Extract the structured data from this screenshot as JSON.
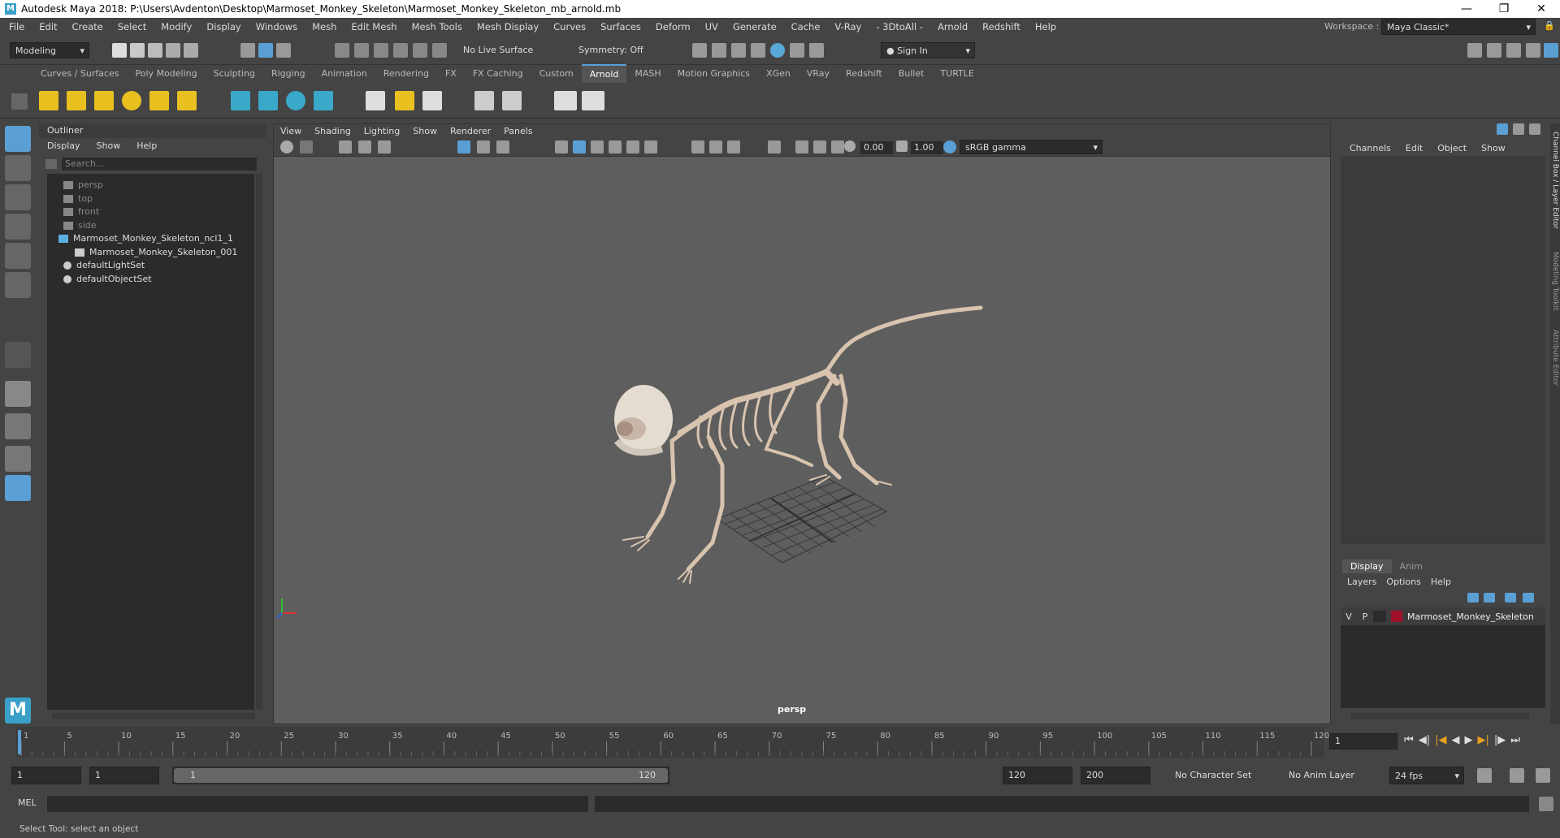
{
  "window": {
    "title": "Autodesk Maya 2018: P:\\Users\\Avdenton\\Desktop\\Marmoset_Monkey_Skeleton\\Marmoset_Monkey_Skeleton_mb_arnold.mb",
    "icon": "maya-icon",
    "controls": [
      "minimize-icon",
      "maximize-icon",
      "close-icon"
    ]
  },
  "menubar": {
    "items": [
      "File",
      "Edit",
      "Create",
      "Select",
      "Modify",
      "Display",
      "Windows",
      "Mesh",
      "Edit Mesh",
      "Mesh Tools",
      "Mesh Display",
      "Curves",
      "Surfaces",
      "Deform",
      "UV",
      "Generate",
      "Cache",
      "V-Ray",
      "- 3DtoAll -",
      "Arnold",
      "Redshift",
      "Help"
    ],
    "workspace_label": "Workspace :",
    "workspace_value": "Maya Classic*"
  },
  "statusline": {
    "mode": "Modeling",
    "live_surface": "No Live Surface",
    "symmetry": "Symmetry: Off",
    "sign_in": "Sign In"
  },
  "shelf": {
    "tabs": [
      "Curves / Surfaces",
      "Poly Modeling",
      "Sculpting",
      "Rigging",
      "Animation",
      "Rendering",
      "FX",
      "FX Caching",
      "Custom",
      "Arnold",
      "MASH",
      "Motion Graphics",
      "XGen",
      "VRay",
      "Redshift",
      "Bullet",
      "TURTLE"
    ],
    "active_tab": "Arnold"
  },
  "outliner": {
    "title": "Outliner",
    "menu": [
      "Display",
      "Show",
      "Help"
    ],
    "search_placeholder": "Search...",
    "items": [
      {
        "label": "persp",
        "icon": "camera-icon",
        "dim": true
      },
      {
        "label": "top",
        "icon": "camera-icon",
        "dim": true
      },
      {
        "label": "front",
        "icon": "camera-icon",
        "dim": true
      },
      {
        "label": "side",
        "icon": "camera-icon",
        "dim": true
      },
      {
        "label": "Marmoset_Monkey_Skeleton_ncl1_1",
        "icon": "joint-icon",
        "dim": false
      },
      {
        "label": "Marmoset_Monkey_Skeleton_001",
        "icon": "mesh-icon",
        "dim": false
      },
      {
        "label": "defaultLightSet",
        "icon": "set-icon",
        "dim": false
      },
      {
        "label": "defaultObjectSet",
        "icon": "set-icon",
        "dim": false
      }
    ]
  },
  "viewport": {
    "menu": [
      "View",
      "Shading",
      "Lighting",
      "Show",
      "Renderer",
      "Panels"
    ],
    "exposure": "0.00",
    "gamma": "1.00",
    "color_space": "sRGB gamma",
    "camera_label": "persp"
  },
  "channelbox": {
    "menu": [
      "Channels",
      "Edit",
      "Object",
      "Show"
    ],
    "side_tabs": [
      "Channel Box / Layer Editor",
      "Modeling Toolkit",
      "Attribute Editor"
    ],
    "layer_tabs": [
      "Display",
      "Anim"
    ],
    "layer_menu": [
      "Layers",
      "Options",
      "Help"
    ],
    "layer": {
      "v": "V",
      "p": "P",
      "name": "Marmoset_Monkey_Skeleton",
      "color": "#a0102a"
    }
  },
  "timeline": {
    "ticks": [
      "1",
      "5",
      "10",
      "15",
      "20",
      "25",
      "30",
      "35",
      "40",
      "45",
      "50",
      "55",
      "60",
      "65",
      "70",
      "75",
      "80",
      "85",
      "90",
      "95",
      "100",
      "105",
      "110",
      "115",
      "120"
    ],
    "current_frame": "1"
  },
  "range": {
    "start": "1",
    "playback_start": "1",
    "slider_start": "1",
    "slider_end": "120",
    "playback_end": "120",
    "end": "200",
    "character_set": "No Character Set",
    "anim_layer": "No Anim Layer",
    "fps": "24 fps"
  },
  "cmdline": {
    "label": "MEL"
  },
  "helpline": {
    "text": "Select Tool: select an object"
  },
  "colors": {
    "accent": "#5a9fd4",
    "viewport_bg": "#5e5e5e",
    "bone": "#d8c3ae"
  }
}
